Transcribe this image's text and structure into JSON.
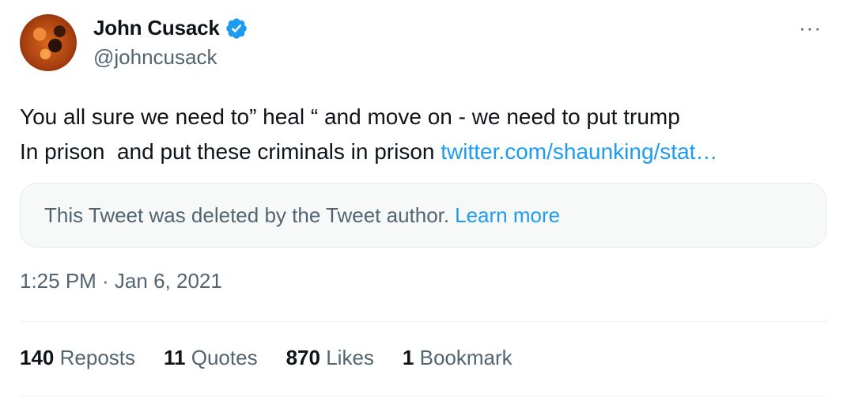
{
  "author": {
    "name": "John Cusack",
    "handle": "@johncusack",
    "verified_icon": "verified-badge-icon",
    "verified_color": "#1d9bf0"
  },
  "menu": {
    "more_label": "···",
    "icon": "more-horizontal-icon"
  },
  "tweet": {
    "line1": "You all sure we need to” heal “ and move on - we need to put trump",
    "line2_text": "In prison  and put these criminals in prison ",
    "link_text": "twitter.com/shaunking/stat…"
  },
  "quoted": {
    "message": "This Tweet was deleted by the Tweet author.",
    "learn_more": "Learn more"
  },
  "timestamp": "1:25 PM · Jan 6, 2021",
  "stats": {
    "reposts_count": "140",
    "reposts_label": "Reposts",
    "quotes_count": "11",
    "quotes_label": "Quotes",
    "likes_count": "870",
    "likes_label": "Likes",
    "bookmarks_count": "1",
    "bookmarks_label": "Bookmark"
  },
  "colors": {
    "text": "#0f1419",
    "muted": "#536471",
    "link": "#1d9bf0"
  }
}
